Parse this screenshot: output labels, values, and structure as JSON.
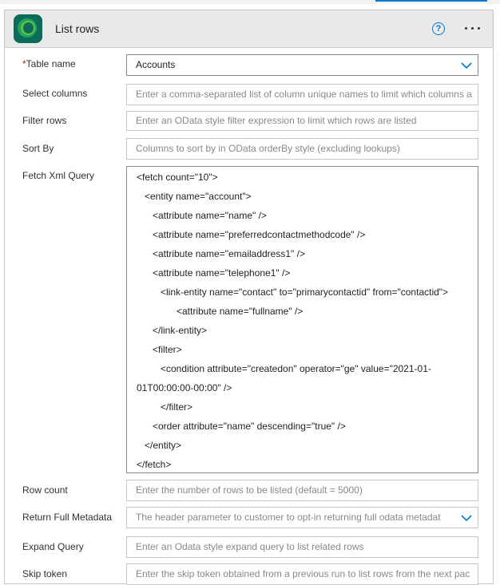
{
  "header": {
    "title": "List rows",
    "help_icon": "?",
    "logo_icon": "dataverse-logo-icon"
  },
  "fields": {
    "table_name": {
      "required_mark": "*",
      "label": "Table name",
      "value": "Accounts"
    },
    "select_columns": {
      "label": "Select columns",
      "placeholder": "Enter a comma-separated list of column unique names to limit which columns a"
    },
    "filter_rows": {
      "label": "Filter rows",
      "placeholder": "Enter an OData style filter expression to limit which rows are listed"
    },
    "sort_by": {
      "label": "Sort By",
      "placeholder": "Columns to sort by in OData orderBy style (excluding lookups)"
    },
    "fetch_xml": {
      "label": "Fetch Xml Query",
      "lines": [
        "<fetch count=\"10\">",
        "<entity name=\"account\">",
        "<attribute name=\"name\" />",
        "<attribute name=\"preferredcontactmethodcode\" />",
        "<attribute name=\"emailaddress1\" />",
        "<attribute name=\"telephone1\" />",
        "<link-entity name=\"contact\" to=\"primarycontactid\" from=\"contactid\">",
        "<attribute name=\"fullname\" />",
        "</link-entity>",
        "<filter>",
        "<condition attribute=\"createdon\" operator=\"ge\" value=\"2021-01-",
        "01T00:00:00-00:00\" />",
        "</filter>",
        "<order attribute=\"name\" descending=\"true\" />",
        "</entity>",
        "</fetch>"
      ]
    },
    "row_count": {
      "label": "Row count",
      "placeholder": "Enter the number of rows to be listed (default = 5000)"
    },
    "return_full_metadata": {
      "label": "Return Full Metadata",
      "placeholder": "The header parameter to customer to opt-in returning full odata metadat"
    },
    "expand_query": {
      "label": "Expand Query",
      "placeholder": "Enter an Odata style expand query to list related rows"
    },
    "skip_token": {
      "label": "Skip token",
      "placeholder": "Enter the skip token obtained from a previous run to list rows from the next pac"
    }
  },
  "colors": {
    "accent": "#0078d4",
    "required": "#a4262c",
    "logo": "#0c6b5a"
  }
}
